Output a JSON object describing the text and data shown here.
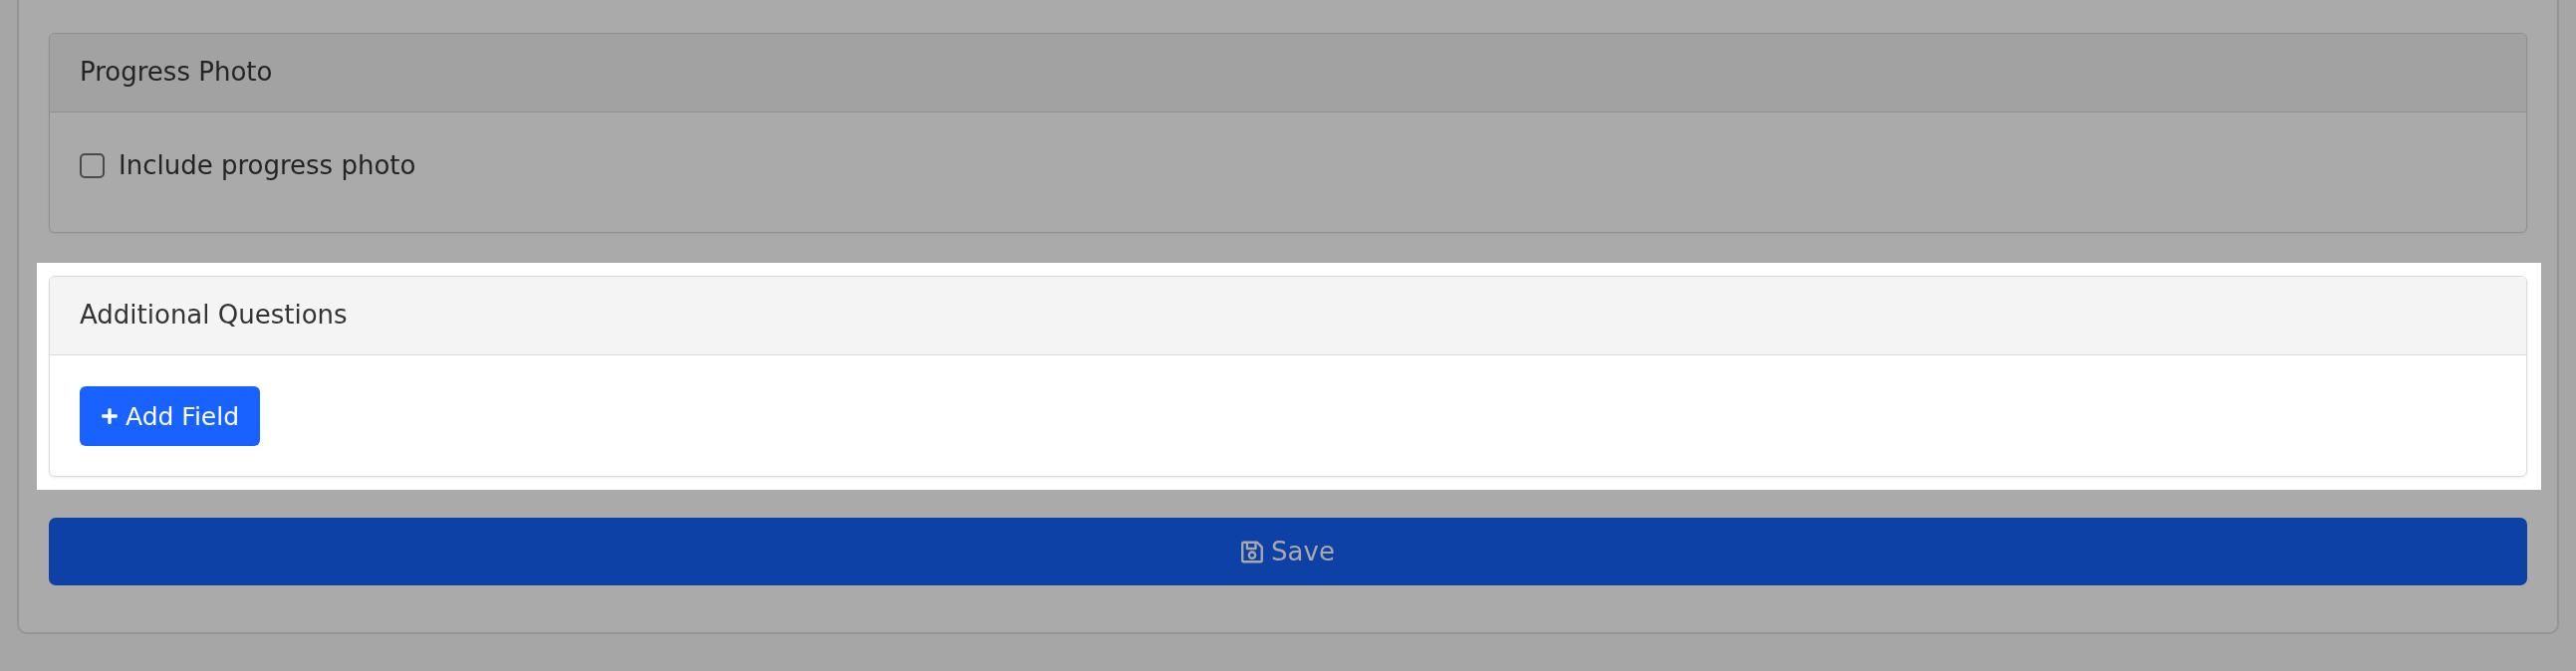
{
  "sections": [
    {
      "kind": "checkbox",
      "title": "Progress Photo",
      "highlighted": false,
      "checkbox": {
        "label": "Include progress photo",
        "checked": false
      }
    },
    {
      "kind": "button",
      "title": "Additional Questions",
      "highlighted": true,
      "button": {
        "label": "Add Field"
      }
    }
  ],
  "save_button": {
    "label": "Save"
  }
}
